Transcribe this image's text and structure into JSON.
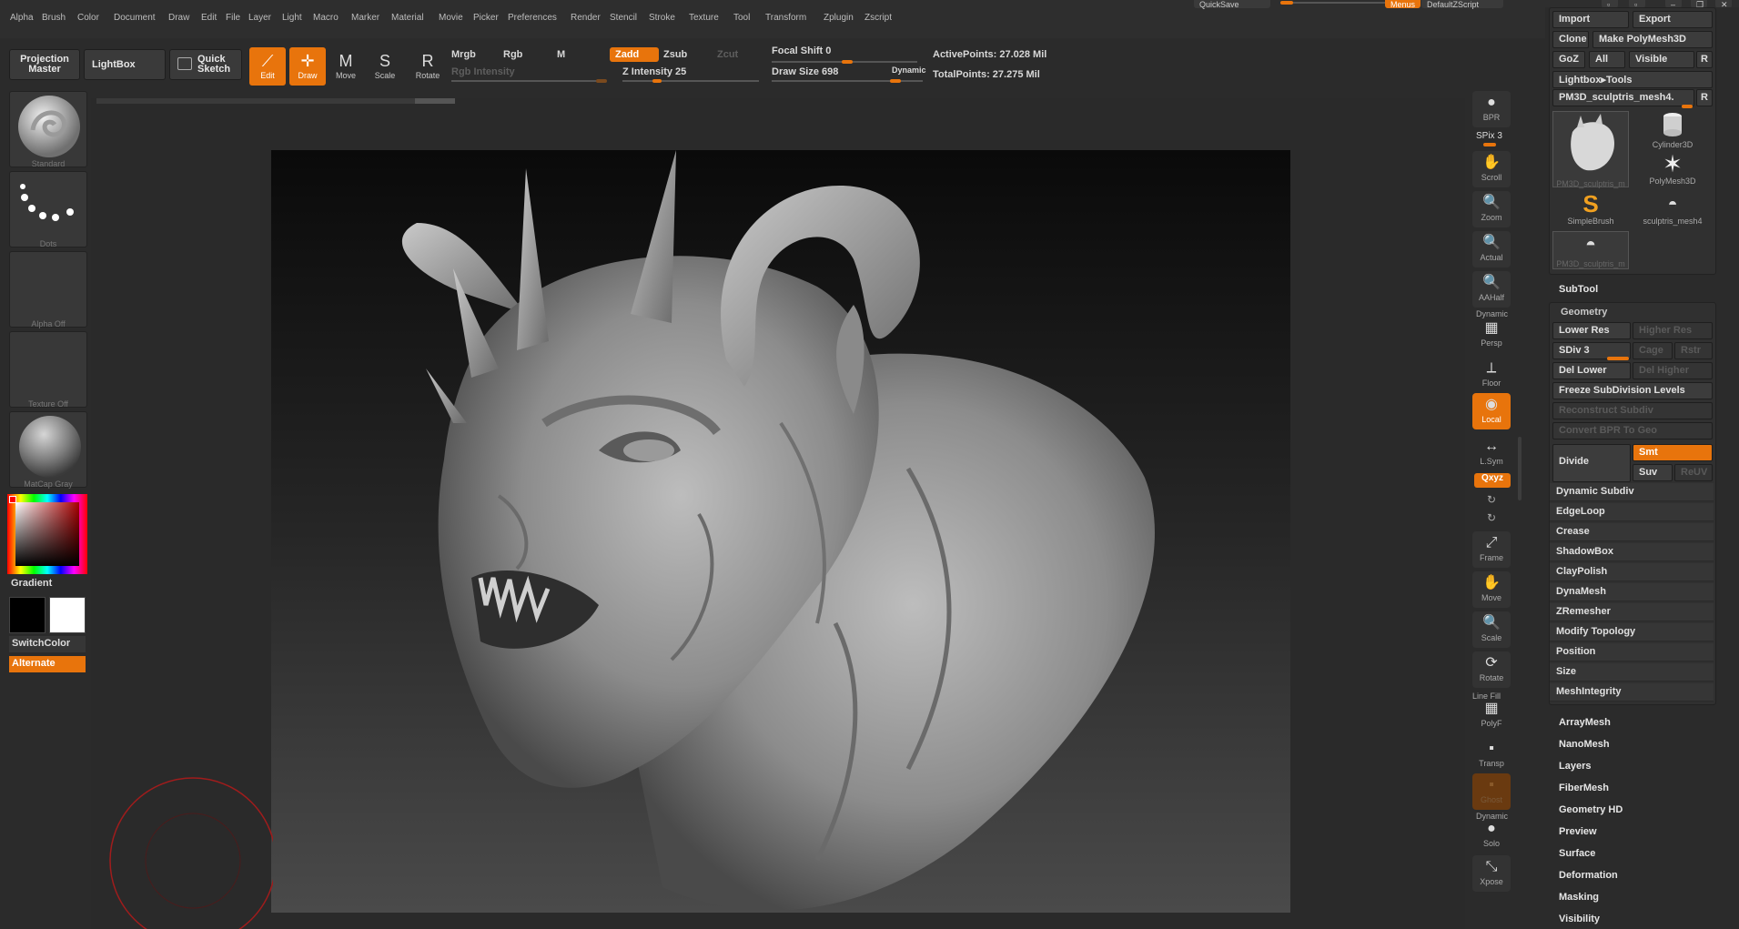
{
  "menu": [
    "Alpha",
    "Brush",
    "Color",
    "Document",
    "Draw",
    "Edit",
    "File",
    "Layer",
    "Light",
    "Macro",
    "Marker",
    "Material",
    "Movie",
    "Picker",
    "Preferences",
    "Render",
    "Stencil",
    "Stroke",
    "Texture",
    "Tool",
    "Transform",
    "Zplugin",
    "Zscript"
  ],
  "topright": {
    "quicksave": "QuickSave",
    "menus": "Menus",
    "script": "DefaultZScript"
  },
  "toolbar": {
    "projection_master": "Projection Master",
    "lightbox": "LightBox",
    "quick_sketch": "Quick Sketch",
    "edit": "Edit",
    "draw": "Draw",
    "move": "Move",
    "scale": "Scale",
    "rotate": "Rotate",
    "mrgb": "Mrgb",
    "rgb": "Rgb",
    "m": "M",
    "rgb_intensity": "Rgb Intensity",
    "zadd": "Zadd",
    "zsub": "Zsub",
    "zcut": "Zcut",
    "z_intensity": "Z Intensity 25",
    "focal_shift": "Focal Shift 0",
    "draw_size": "Draw Size 698",
    "dynamic": "Dynamic",
    "active_points": "ActivePoints: 27.028 Mil",
    "total_points": "TotalPoints: 27.275 Mil",
    "z_intensity_value": 25,
    "z_intensity_max": 100
  },
  "left": {
    "brush": "Standard",
    "stroke": "Dots",
    "alpha": "Alpha Off",
    "texture": "Texture Off",
    "material": "MatCap Gray",
    "gradient": "Gradient",
    "switch_color": "SwitchColor",
    "alternate": "Alternate"
  },
  "shelf": {
    "bpr": "BPR",
    "spix": "SPix 3",
    "scroll": "Scroll",
    "zoom": "Zoom",
    "actual": "Actual",
    "aahalf": "AAHalf",
    "dynamic": "Dynamic",
    "persp": "Persp",
    "floor": "Floor",
    "local": "Local",
    "lsym": "L.Sym",
    "xyz": "Qxyz",
    "frame": "Frame",
    "move": "Move",
    "scale": "Scale",
    "rotate": "Rotate",
    "line_fill": "Line Fill",
    "polyf": "PolyF",
    "transp": "Transp",
    "ghost": "Ghost",
    "dynamic2": "Dynamic",
    "solo": "Solo",
    "xpose": "Xpose"
  },
  "tool": {
    "import": "Import",
    "export": "Export",
    "clone": "Clone",
    "make_polymesh": "Make PolyMesh3D",
    "goz": "GoZ",
    "all": "All",
    "visible": "Visible",
    "r": "R",
    "lightbox_tools": "Lightbox▸Tools",
    "current_tool": "PM3D_sculptris_mesh4.",
    "thumbs": [
      "PM3D_sculptris_m",
      "Cylinder3D",
      "PolyMesh3D",
      "SimpleBrush",
      "sculptris_mesh4",
      "PM3D_sculptris_m"
    ],
    "subtool": "SubTool",
    "geometry": "Geometry",
    "lower_res": "Lower Res",
    "higher_res": "Higher Res",
    "sdiv": "SDiv 3",
    "cage": "Cage",
    "rstr": "Rstr",
    "del_lower": "Del Lower",
    "del_higher": "Del Higher",
    "freeze": "Freeze SubDivision Levels",
    "reconstruct": "Reconstruct Subdiv",
    "convert_bpr": "Convert BPR To Geo",
    "divide": "Divide",
    "smt": "Smt",
    "suv": "Suv",
    "reuv": "ReUV",
    "geometry_items": [
      "Dynamic Subdiv",
      "EdgeLoop",
      "Crease",
      "ShadowBox",
      "ClayPolish",
      "DynaMesh",
      "ZRemesher",
      "Modify Topology",
      "Position",
      "Size",
      "MeshIntegrity"
    ],
    "sections": [
      "ArrayMesh",
      "NanoMesh",
      "Layers",
      "FiberMesh",
      "Geometry HD",
      "Preview",
      "Surface",
      "Deformation",
      "Masking",
      "Visibility"
    ]
  },
  "colors": {
    "accent": "#e8740c",
    "panel": "#2b2b2b",
    "button": "#3c3c3c"
  }
}
